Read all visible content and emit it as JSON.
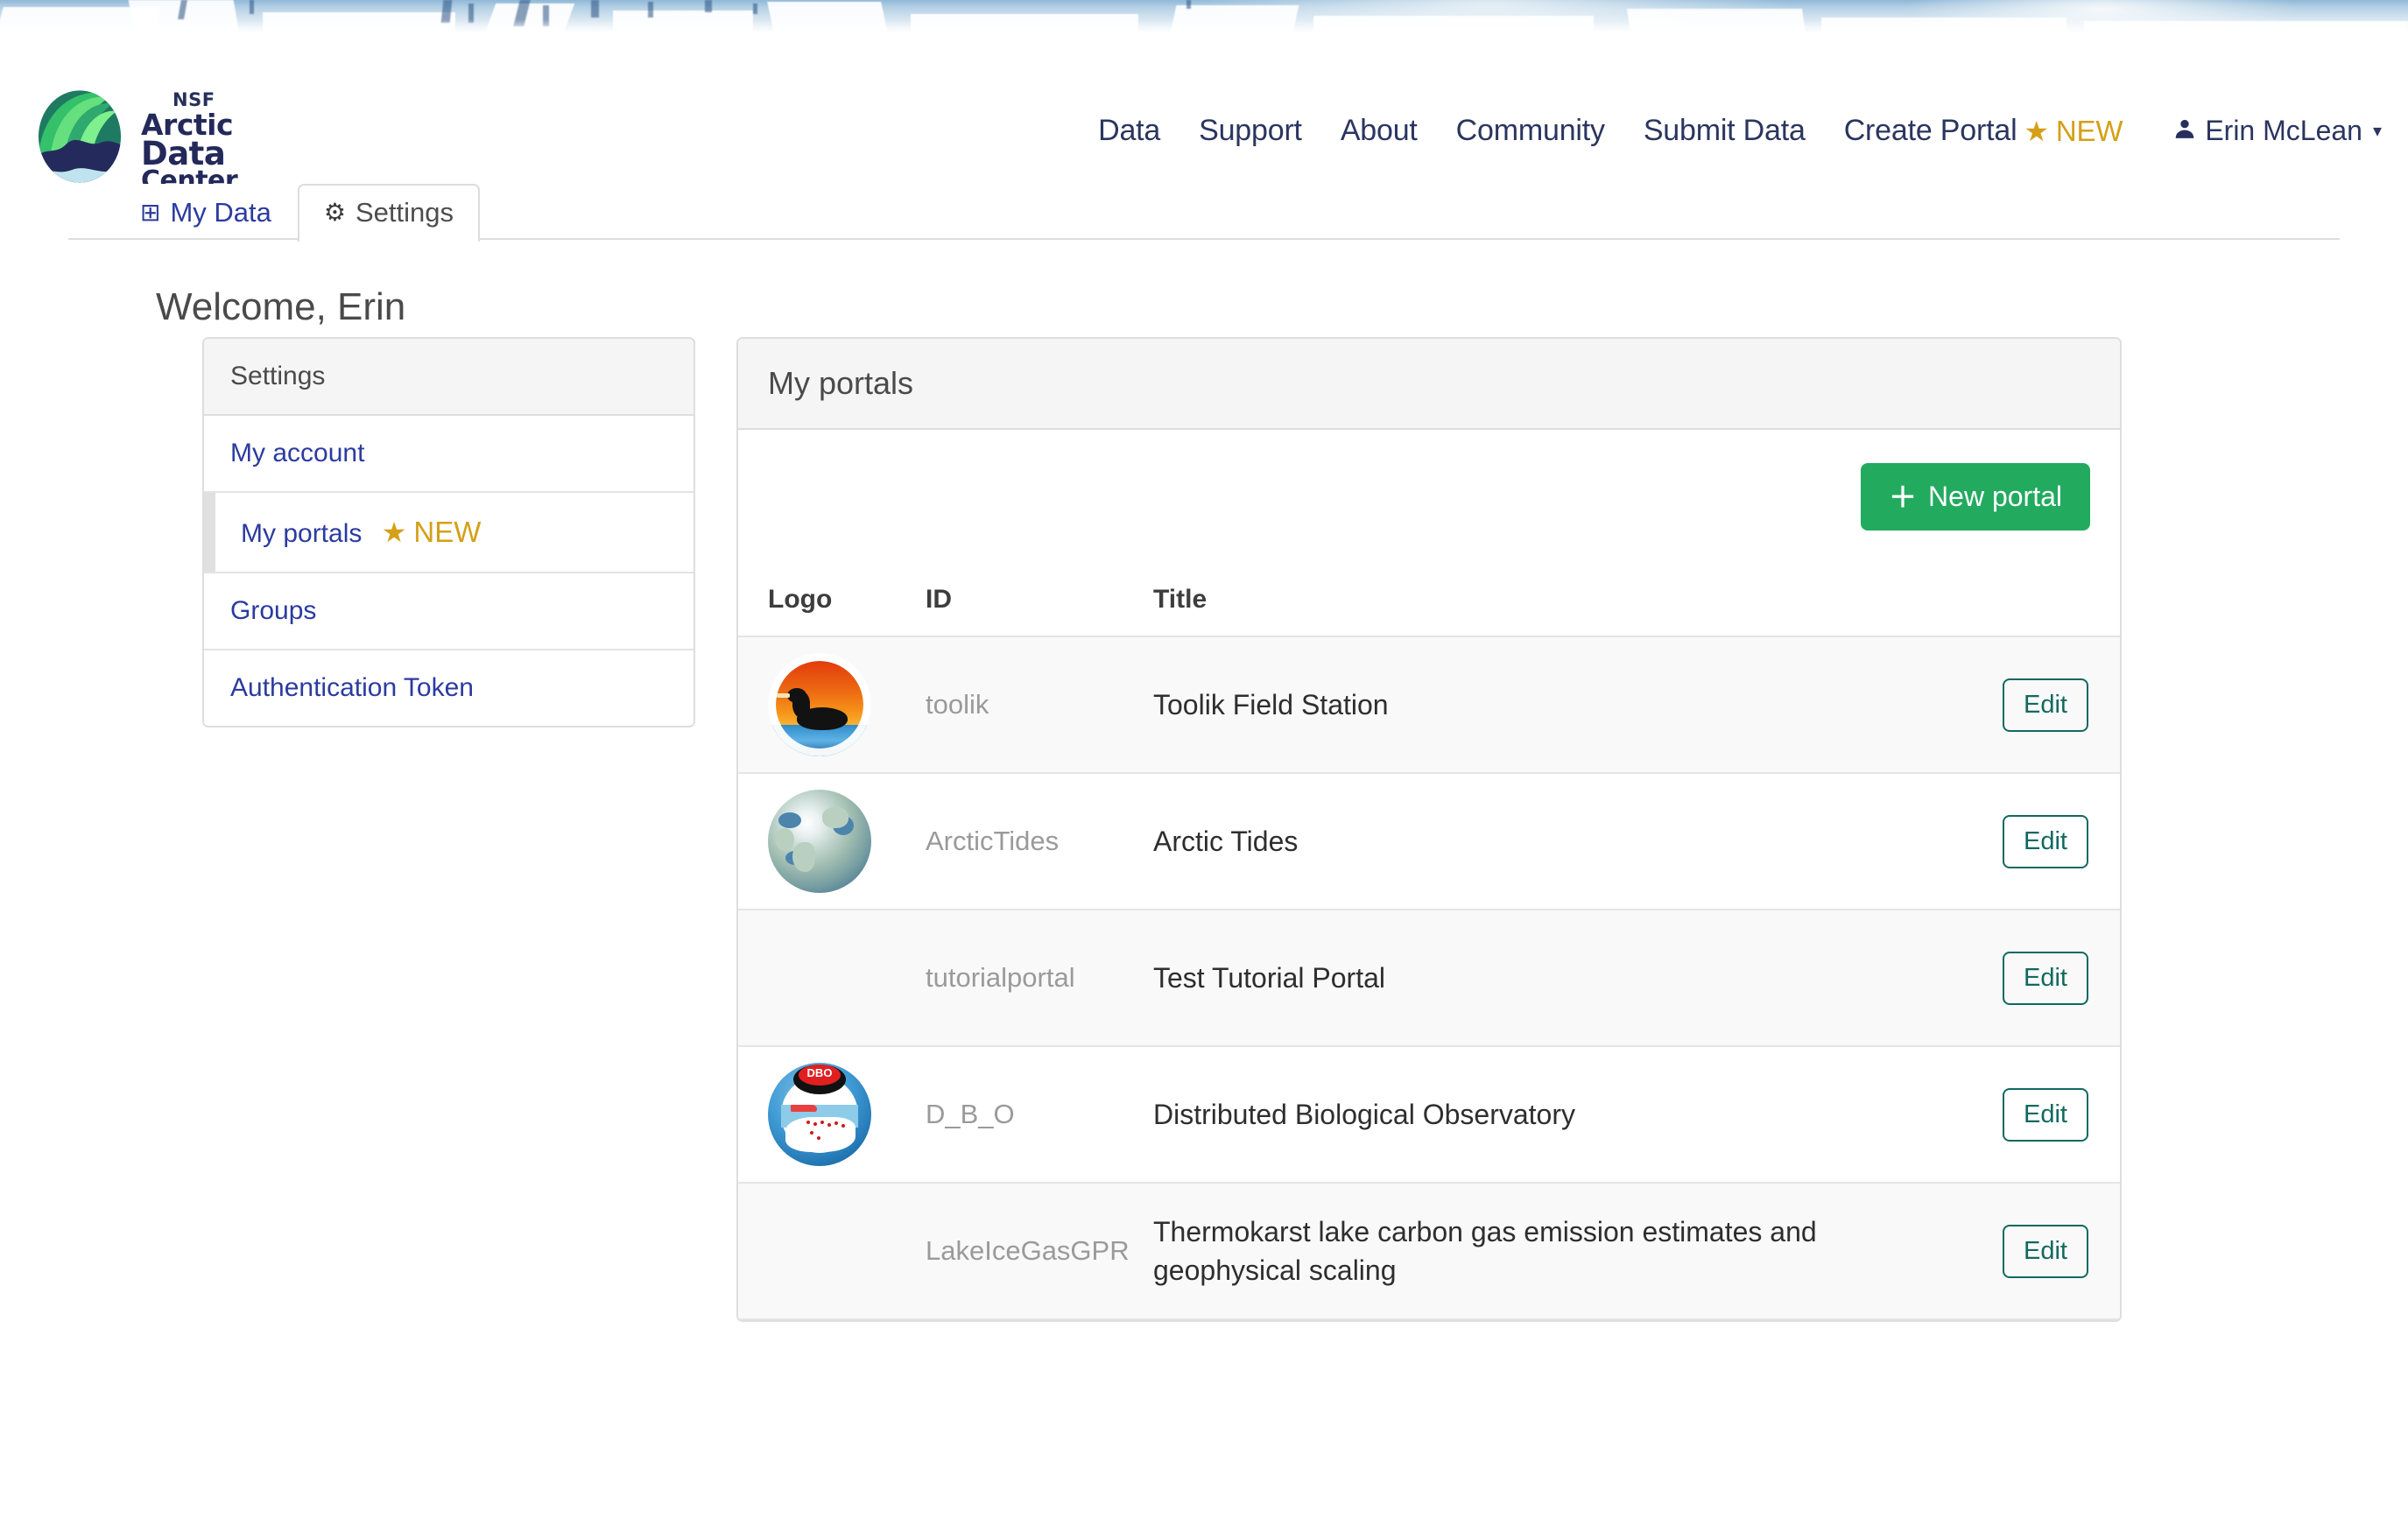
{
  "banner": {
    "alt": "arctic-ice-landscape-banner"
  },
  "brand": {
    "nsf": "NSF",
    "line1": "Arctic",
    "line2": "Data",
    "line3": "Center",
    "logo_icon": "aurora-globe-logo"
  },
  "nav": {
    "items": [
      {
        "label": "Data"
      },
      {
        "label": "Support"
      },
      {
        "label": "About"
      },
      {
        "label": "Community"
      },
      {
        "label": "Submit Data"
      },
      {
        "label": "Create Portal",
        "badge": "NEW",
        "star": "★"
      }
    ],
    "user": {
      "name": "Erin McLean",
      "icon": "👤",
      "caret": "▾"
    }
  },
  "tabs": [
    {
      "label": "My Data",
      "icon": "⊞",
      "icon_name": "table-icon",
      "active": false
    },
    {
      "label": "Settings",
      "icon": "⚙",
      "icon_name": "gear-icon",
      "active": true
    }
  ],
  "page": {
    "welcome": "Welcome, Erin"
  },
  "sidebar": {
    "title": "Settings",
    "items": [
      {
        "label": "My account",
        "active": false
      },
      {
        "label": "My portals",
        "active": true,
        "badge": "NEW",
        "star": "★"
      },
      {
        "label": "Groups",
        "active": false
      },
      {
        "label": "Authentication Token",
        "active": false
      }
    ]
  },
  "portals_panel": {
    "title": "My portals",
    "new_button": {
      "label": "New portal",
      "plus": "＋"
    },
    "columns": {
      "logo": "Logo",
      "id": "ID",
      "title": "Title"
    },
    "edit_label": "Edit",
    "rows": [
      {
        "logo": "toolik-field-station-loon-logo",
        "id": "toolik",
        "title": "Toolik Field Station",
        "edit": "Edit"
      },
      {
        "logo": "arctic-globe-logo",
        "id": "ArcticTides",
        "title": "Arctic Tides",
        "edit": "Edit"
      },
      {
        "logo": "no-logo",
        "id": "tutorialportal",
        "title": "Test Tutorial Portal",
        "edit": "Edit"
      },
      {
        "logo": "dbo-observatory-logo",
        "id": "D_B_O",
        "title": "Distributed Biological Observatory",
        "edit": "Edit"
      },
      {
        "logo": "no-logo",
        "id": "LakeIceGasGPR",
        "title": "Thermokarst lake carbon gas emission estimates and geophysical scaling",
        "edit": "Edit"
      }
    ]
  },
  "colors": {
    "nav_text": "#2b3560",
    "link": "#2b3ba0",
    "new_badge": "#d4a017",
    "new_portal_button": "#22aa5f",
    "edit_button": "#11695f",
    "panel_header_bg": "#f5f5f5",
    "row_stripe": "#f9f9f9"
  }
}
